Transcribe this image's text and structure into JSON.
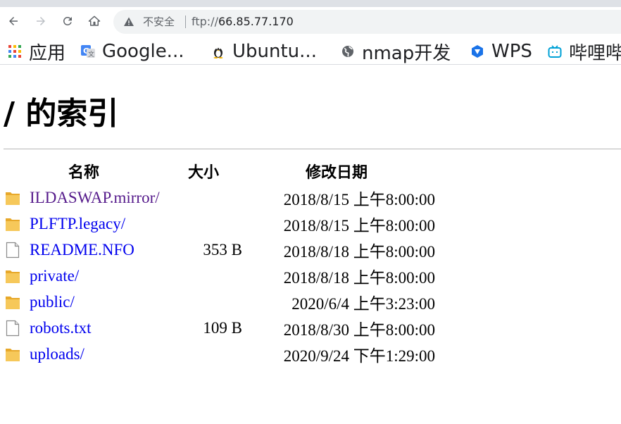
{
  "browser": {
    "security_label": "不安全",
    "url_scheme": "ftp://",
    "url_host": "66.85.77.170"
  },
  "bookmarks": [
    {
      "label": "应用",
      "icon": "apps-grid-icon"
    },
    {
      "label": "Google...",
      "icon": "google-translate-icon"
    },
    {
      "label": "Ubuntu...",
      "icon": "tux-icon"
    },
    {
      "label": "nmap开发",
      "icon": "globe-icon"
    },
    {
      "label": "WPS",
      "icon": "wps-icon"
    },
    {
      "label": "哔哩哔",
      "icon": "bilibili-icon"
    }
  ],
  "page": {
    "title_slash": "/",
    "title_text": "的索引",
    "headers": {
      "name": "名称",
      "size": "大小",
      "modified": "修改日期"
    }
  },
  "entries": [
    {
      "name": "ILDASWAP.mirror/",
      "type": "folder",
      "size": "",
      "modified": "2018/8/15 上午8:00:00",
      "visited": true
    },
    {
      "name": "PLFTP.legacy/",
      "type": "folder",
      "size": "",
      "modified": "2018/8/15 上午8:00:00",
      "visited": false
    },
    {
      "name": "README.NFO",
      "type": "file",
      "size": "353 B",
      "modified": "2018/8/18 上午8:00:00",
      "visited": false
    },
    {
      "name": "private/",
      "type": "folder",
      "size": "",
      "modified": "2018/8/18 上午8:00:00",
      "visited": false
    },
    {
      "name": "public/",
      "type": "folder",
      "size": "",
      "modified": "2020/6/4 上午3:23:00",
      "visited": false
    },
    {
      "name": "robots.txt",
      "type": "file",
      "size": "109 B",
      "modified": "2018/8/30 上午8:00:00",
      "visited": false
    },
    {
      "name": "uploads/",
      "type": "folder",
      "size": "",
      "modified": "2020/9/24 下午1:29:00",
      "visited": false
    }
  ],
  "colors": {
    "link": "#0000ee",
    "visited_link": "#551a8b",
    "folder": "#f5c343",
    "chrome_bg": "#dee1e6",
    "omnibox_bg": "#f1f3f4"
  }
}
